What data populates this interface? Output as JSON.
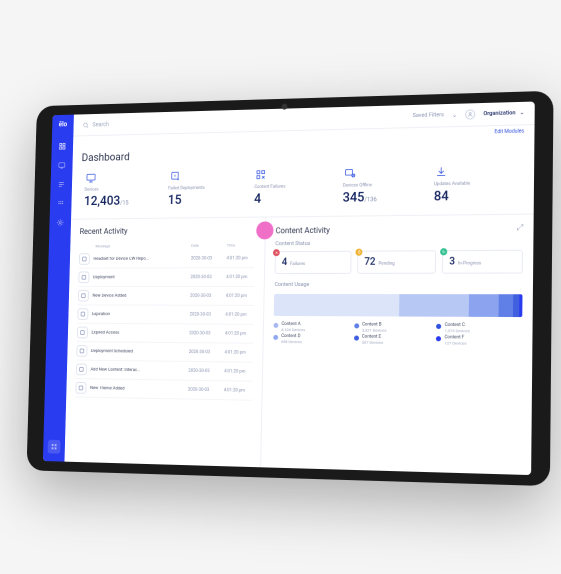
{
  "brand": "ēlo",
  "search_placeholder": "Search",
  "topbar": {
    "filters": "Saved Filters",
    "org": "Organization",
    "edit": "Edit Modules"
  },
  "page_title": "Dashboard",
  "stats": [
    {
      "label": "Devices",
      "value": "12,403",
      "sub": "/15"
    },
    {
      "label": "Failed Deployments",
      "value": "15",
      "sub": ""
    },
    {
      "label": "Content Failures",
      "value": "4",
      "sub": ""
    },
    {
      "label": "Devices Offline",
      "value": "345",
      "sub": "/136"
    },
    {
      "label": "Updates Available",
      "value": "84",
      "sub": ""
    }
  ],
  "recent": {
    "title": "Recent Activity",
    "cols": [
      "",
      "Message",
      "Date",
      "Time"
    ],
    "rows": [
      {
        "msg": "Headset for Device CW Repo...",
        "date": "2020-30-03",
        "time": "4:01:20 pm"
      },
      {
        "msg": "Deployment",
        "date": "2020-30-03",
        "time": "4:01:20 pm"
      },
      {
        "msg": "New Device Added",
        "date": "2020-30-03",
        "time": "4:01:20 pm"
      },
      {
        "msg": "Expiration",
        "date": "2020-30-03",
        "time": "4:01:20 pm"
      },
      {
        "msg": "Expired Access",
        "date": "2020-30-03",
        "time": "4:01:20 pm"
      },
      {
        "msg": "Deployment Scheduled",
        "date": "2020-30-03",
        "time": "4:01:20 pm"
      },
      {
        "msg": "Add New Content: Interac...",
        "date": "2020-30-03",
        "time": "4:01:20 pm"
      },
      {
        "msg": "New Theme Added",
        "date": "2020-30-03",
        "time": "4:01:20 pm"
      }
    ]
  },
  "content_activity": {
    "title": "Content Activity",
    "status_title": "Content Status",
    "statuses": [
      {
        "val": "4",
        "label": "Failures",
        "color": "red"
      },
      {
        "val": "72",
        "label": "Pending",
        "color": "yel"
      },
      {
        "val": "3",
        "label": "In-Progress",
        "color": "grn"
      }
    ],
    "usage_title": "Content Usage",
    "legend": [
      {
        "name": "Content A",
        "sub": "6,104 Devices",
        "color": "#a8b8f0"
      },
      {
        "name": "Content B",
        "sub": "3,321 Devices",
        "color": "#6080e8"
      },
      {
        "name": "Content C",
        "sub": "1,373 Devices",
        "color": "#3050e0"
      },
      {
        "name": "Content D",
        "sub": "658 Devices",
        "color": "#90a8f0"
      },
      {
        "name": "Content E",
        "sub": "307 Devices",
        "color": "#4060e0"
      },
      {
        "name": "Content F",
        "sub": "127 Devices",
        "color": "#2a3cf0"
      }
    ]
  },
  "chart_data": {
    "type": "bar",
    "title": "Content Usage",
    "series": [
      {
        "name": "Content A",
        "value": 6104,
        "color": "#dce4fa"
      },
      {
        "name": "Content B",
        "value": 3321,
        "color": "#b8c8f5"
      },
      {
        "name": "Content C",
        "value": 1373,
        "color": "#8ca4f0"
      },
      {
        "name": "Content D",
        "value": 658,
        "color": "#6080e8"
      },
      {
        "name": "Content E",
        "value": 307,
        "color": "#4060e0"
      },
      {
        "name": "Content F",
        "value": 127,
        "color": "#2a3cf0"
      }
    ]
  }
}
